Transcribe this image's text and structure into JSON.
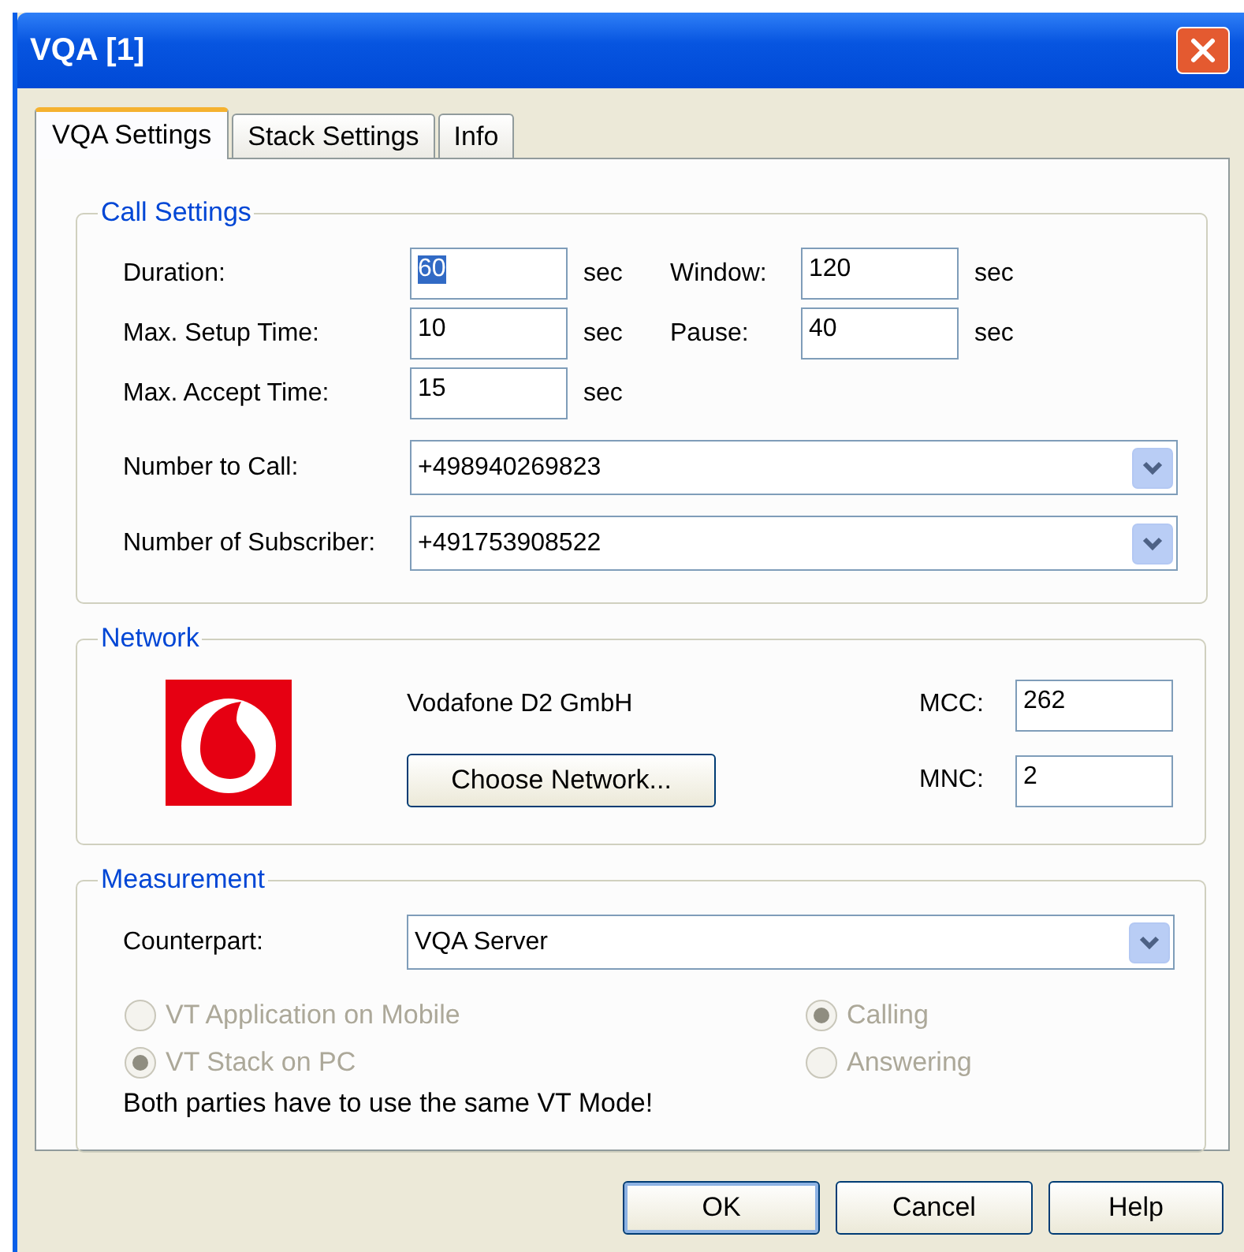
{
  "window": {
    "title": "VQA [1]"
  },
  "tabs": [
    {
      "label": "VQA Settings",
      "selected": true
    },
    {
      "label": "Stack Settings",
      "selected": false
    },
    {
      "label": "Info",
      "selected": false
    }
  ],
  "call_settings": {
    "title": "Call Settings",
    "rows": [
      {
        "label": "Duration:",
        "value": "60",
        "text_selected": true,
        "unit": "sec",
        "label_2": "Window:",
        "value_2": "120",
        "unit_2": "sec"
      },
      {
        "label": "Max. Setup Time:",
        "value": "10",
        "text_selected": false,
        "unit": "sec",
        "label_2": "Pause:",
        "value_2": "40",
        "unit_2": "sec"
      },
      {
        "label": "Max. Accept Time:",
        "value": "15",
        "text_selected": false,
        "unit": "sec"
      }
    ],
    "combos": [
      {
        "label": "Number to Call:",
        "value": "+498940269823"
      },
      {
        "label": "Number of Subscriber:",
        "value": "+491753908522"
      }
    ]
  },
  "network": {
    "title": "Network",
    "operator": "Vodafone D2 GmbH",
    "button": "Choose Network...",
    "fields": [
      {
        "label": "MCC:",
        "value": "262"
      },
      {
        "label": "MNC:",
        "value": "2"
      }
    ]
  },
  "measurement": {
    "title": "Measurement",
    "counterpart": {
      "label": "Counterpart:",
      "value": "VQA Server"
    },
    "modes": [
      {
        "label": "VT Application on Mobile",
        "selected": false,
        "disabled": true
      },
      {
        "label": "VT Stack on PC",
        "selected": true,
        "disabled": true
      }
    ],
    "directions": [
      {
        "label": "Calling",
        "selected": true,
        "disabled": true
      },
      {
        "label": "Answering",
        "selected": false,
        "disabled": true
      }
    ],
    "note": "Both parties have to use the same VT Mode!"
  },
  "buttons": [
    {
      "label": "OK",
      "default": true
    },
    {
      "label": "Cancel",
      "default": false
    },
    {
      "label": "Help",
      "default": false
    }
  ]
}
